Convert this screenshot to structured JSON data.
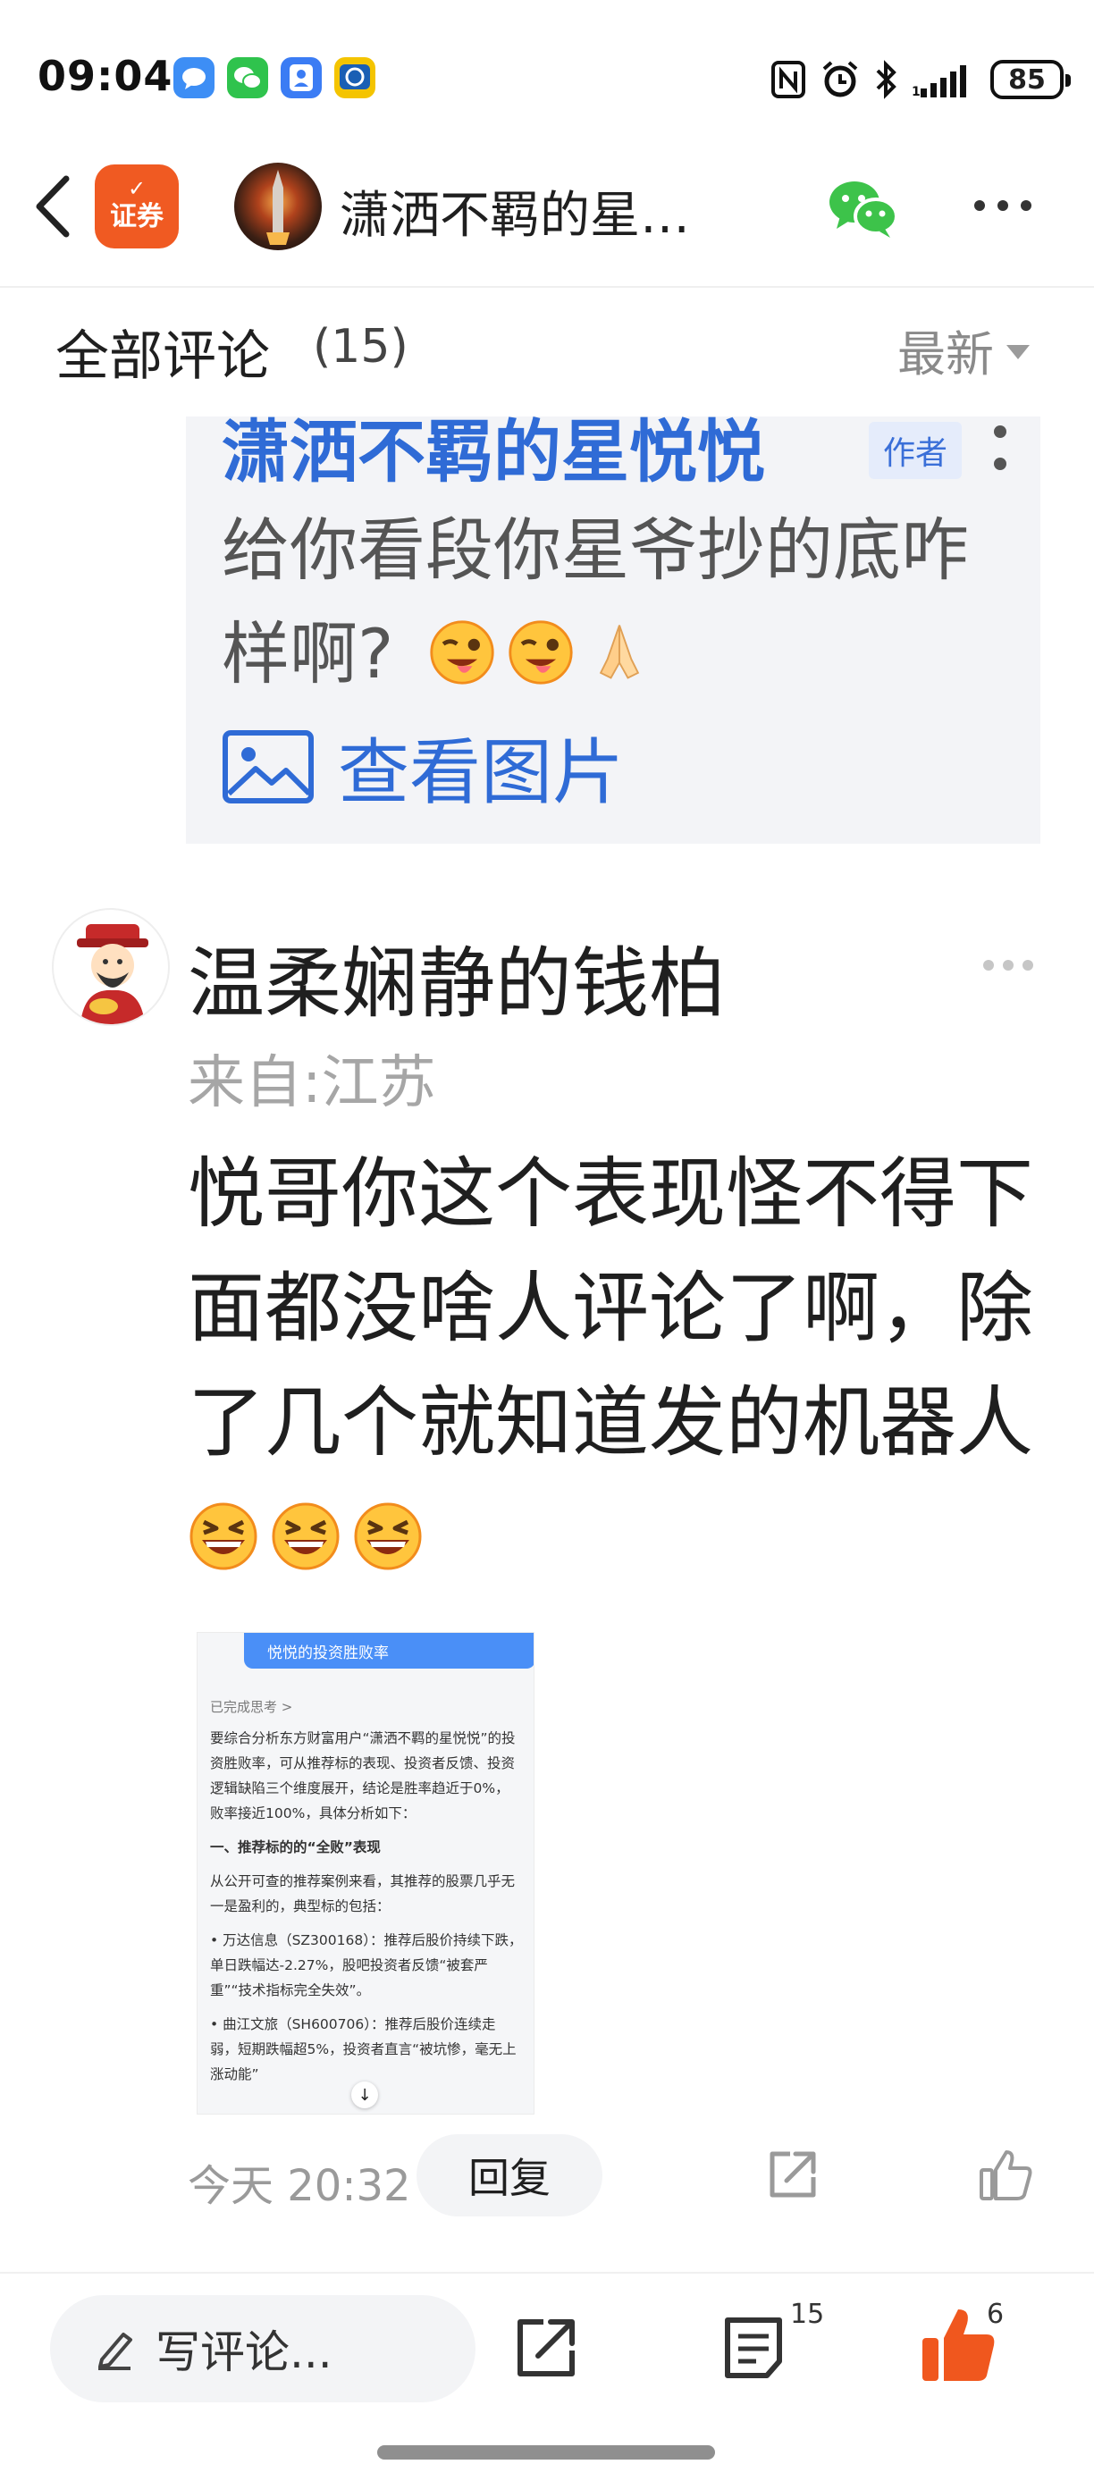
{
  "status_bar": {
    "time": "09:04",
    "battery": "85",
    "icons": [
      "message-app-icon",
      "wechat-app-icon",
      "contacts-app-icon",
      "china-post-app-icon",
      "nfc-icon",
      "alarm-icon",
      "bluetooth-icon",
      "signal-icon",
      "battery-icon"
    ]
  },
  "header": {
    "app_badge": "证券",
    "author_name": "潇洒不羁的星…",
    "icons": [
      "back-arrow-icon",
      "share-wechat-icon",
      "more-dots-icon"
    ]
  },
  "comments_header": {
    "title": "全部评论",
    "count": "(15)",
    "sort_label": "最新"
  },
  "quoted_reply": {
    "author": "潇洒不羁的星悦悦",
    "tag": "作者",
    "text": "给你看段你星爷抄的底咋样啊?",
    "emojis": [
      "winking-tongue-emoji",
      "winking-tongue-emoji",
      "folded-hands-emoji"
    ],
    "view_image_label": "查看图片"
  },
  "comment": {
    "name": "温柔娴静的钱柏",
    "location": "来自:江苏",
    "body": "悦哥你这个表现怪不得下面都没啥人评论了啊，除了几个就知道发的机器人",
    "emojis": [
      "grinning-squinting-emoji",
      "grinning-squinting-emoji",
      "grinning-squinting-emoji"
    ],
    "time": "今天 20:32",
    "reply_label": "回复",
    "screenshot": {
      "bubble": "悦悦的投资胜败率",
      "status": "已完成思考 >",
      "paragraphs": [
        "要综合分析东方财富用户“潇洒不羁的星悦悦”的投资胜败率，可从推荐标的表现、投资者反馈、投资逻辑缺陷三个维度展开，结论是胜率趋近于0%，败率接近100%，具体分析如下：",
        "一、推荐标的的“全败”表现",
        "从公开可查的推荐案例来看，其推荐的股票几乎无一是盈利的，典型标的包括：",
        "• 万达信息（SZ300168）：推荐后股价持续下跌，单日跌幅达-2.27%，股吧投资者反馈“被套严重”“技术指标完全失效”。",
        "• 曲江文旅（SH600706）：推荐后股价连续走弱，短期跌幅超5%，投资者直言“被坑惨，毫无上涨动能”"
      ]
    }
  },
  "bottom_bar": {
    "write_placeholder": "写评论...",
    "comments_count": "15",
    "likes_count": "6"
  },
  "colors": {
    "accent_orange": "#f05a22",
    "link_blue": "#2f6bd6",
    "like_orange": "#f0571e",
    "wechat_green": "#3dc34a"
  }
}
